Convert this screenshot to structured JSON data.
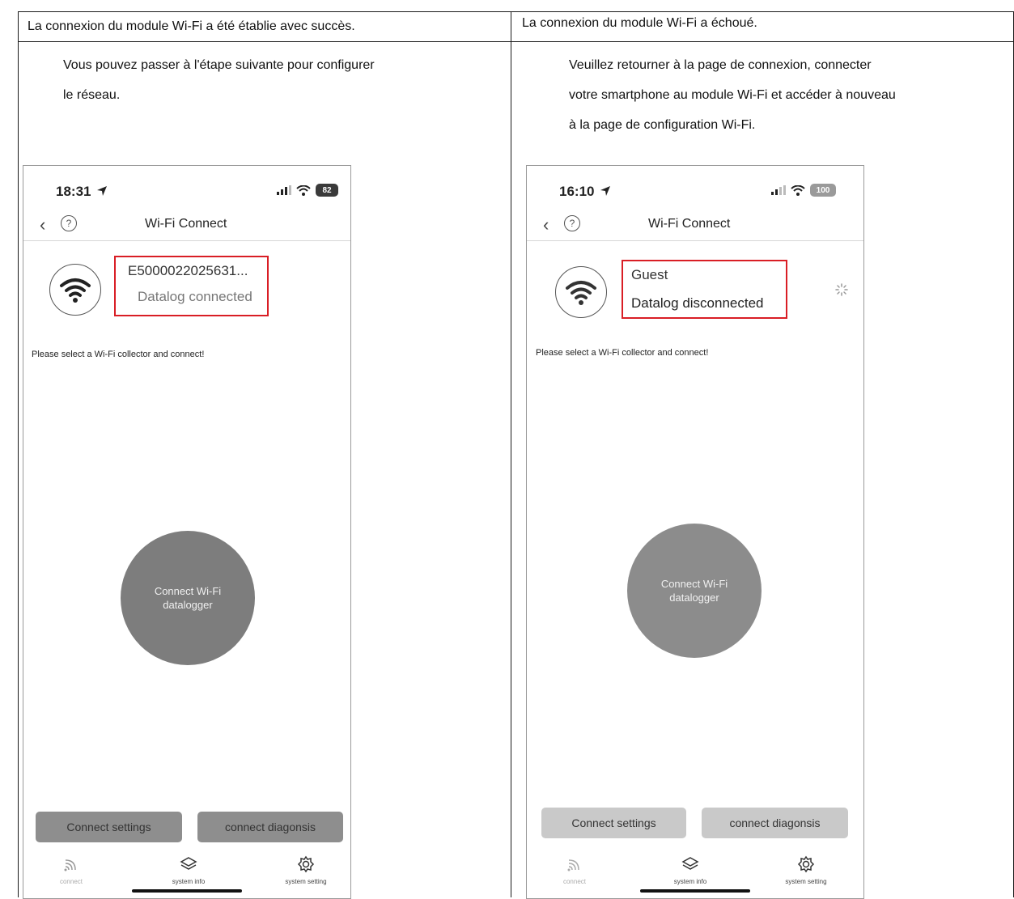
{
  "table": {
    "left_header": "La connexion du module Wi-Fi a été établie avec succès.",
    "right_header": "La connexion du module Wi-Fi a échoué.",
    "left_text_lines": [
      "Vous pouvez passer à l'étape suivante pour configurer",
      "le réseau."
    ],
    "right_text_lines": [
      "Veuillez retourner à la page de connexion, connecter",
      "votre smartphone au module Wi-Fi et accéder à nouveau",
      "à la page de configuration Wi-Fi."
    ]
  },
  "phones": [
    {
      "time": "18:31",
      "battery": "82",
      "nav_title": "Wi-Fi Connect",
      "device_name": "E5000022025631...",
      "device_status": "Datalog connected",
      "hint": "Please select a Wi-Fi collector and connect!",
      "connect_button": "Connect Wi-Fi datalogger",
      "settings_button": "Connect settings",
      "diagnosis_button": "connect diagonsis",
      "tabs": [
        "connect",
        "system info",
        "system setting"
      ]
    },
    {
      "time": "16:10",
      "battery": "100",
      "nav_title": "Wi-Fi Connect",
      "device_name": "Guest",
      "device_status": "Datalog disconnected",
      "hint": "Please select a Wi-Fi collector and connect!",
      "connect_button": "Connect Wi-Fi datalogger",
      "settings_button": "Connect settings",
      "diagnosis_button": "connect diagonsis",
      "tabs": [
        "connect",
        "system info",
        "system setting"
      ]
    }
  ],
  "colors": {
    "highlight_box": "#d91e25",
    "battery_dark": "#3a3a3a",
    "battery_light": "#9a9a9a",
    "button_dark": "#7d7d7d",
    "button_light": "#8c8c8c",
    "pill_dark": "#8e8e8e",
    "pill_light": "#c9c9c9"
  },
  "icons": [
    "wifi-icon",
    "location-arrow-icon",
    "signal-bars-icon",
    "battery-icon",
    "back-chevron-icon",
    "help-circle-icon",
    "loading-spinner-icon",
    "connect-tab-icon",
    "layers-icon",
    "gear-icon"
  ]
}
